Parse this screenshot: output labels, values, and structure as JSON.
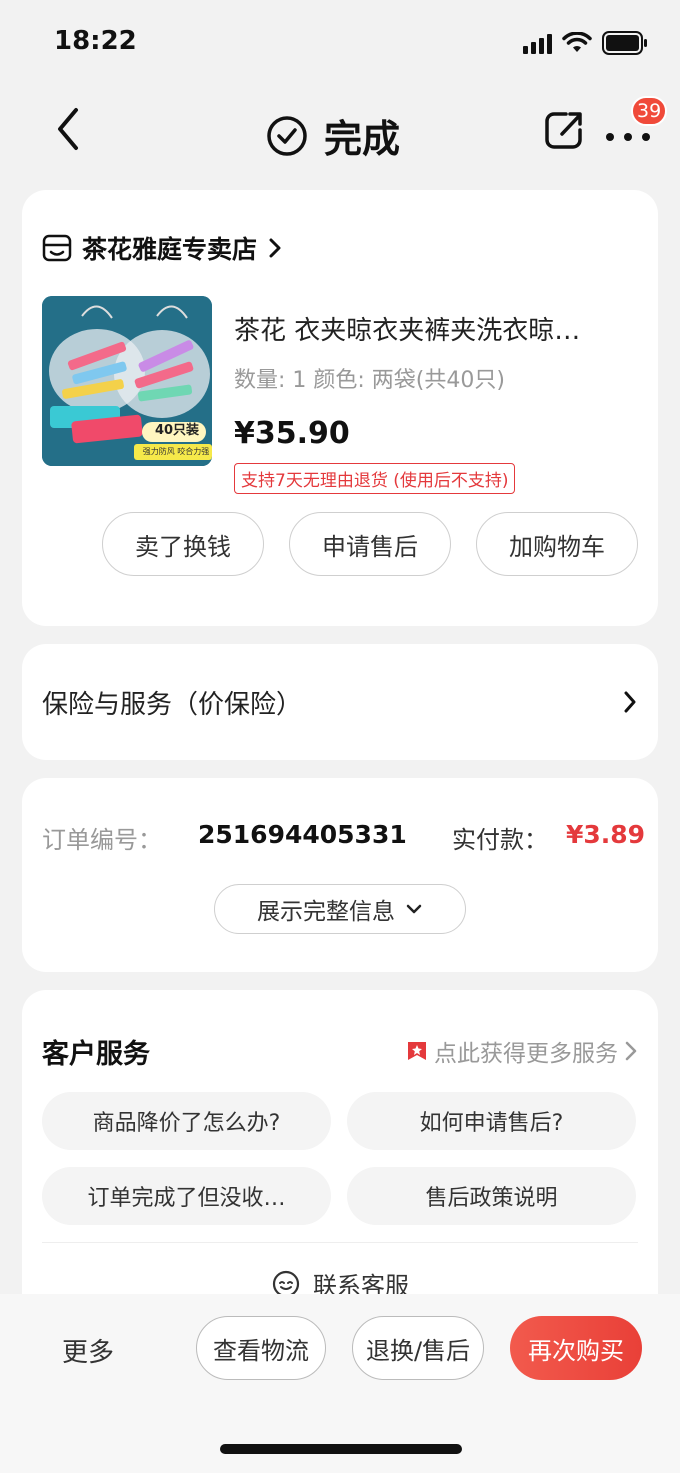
{
  "status_bar": {
    "time": "18:22"
  },
  "nav": {
    "title": "完成",
    "badge_count": "39",
    "icons": [
      "back-icon",
      "check-circle-icon",
      "share-icon",
      "more-icon"
    ]
  },
  "product_card": {
    "shop_name": "茶花雅庭专卖店",
    "product_title": "茶花 衣夹晾衣夹裤夹洗衣晾…",
    "spec": "数量: 1  颜色: 两袋(共40只)",
    "price": "¥35.90",
    "return_tag": "支持7天无理由退货 (使用后不支持)",
    "image_text": {
      "badge": "40只装",
      "caption": "强力防风 咬合力强"
    },
    "actions": [
      "卖了换钱",
      "申请售后",
      "加购物车"
    ]
  },
  "insurance": {
    "label": "保险与服务（价保险）"
  },
  "order": {
    "number_label": "订单编号：",
    "number": "251694405331",
    "paid_label": "实付款：",
    "paid_amount": "¥3.89",
    "expand_label": "展示完整信息"
  },
  "service": {
    "title": "客户服务",
    "more_label": "点此获得更多服务",
    "questions": [
      "商品降价了怎么办?",
      "如何申请售后?",
      "订单完成了但没收…",
      "售后政策说明"
    ],
    "contact_label": "联系客服"
  },
  "bottom_bar": {
    "more": "更多",
    "logistics": "查看物流",
    "after_sale": "退换/售后",
    "rebuy": "再次购买"
  },
  "colors": {
    "accent_red": "#e4393c",
    "primary_button": "#ec4a3f"
  }
}
